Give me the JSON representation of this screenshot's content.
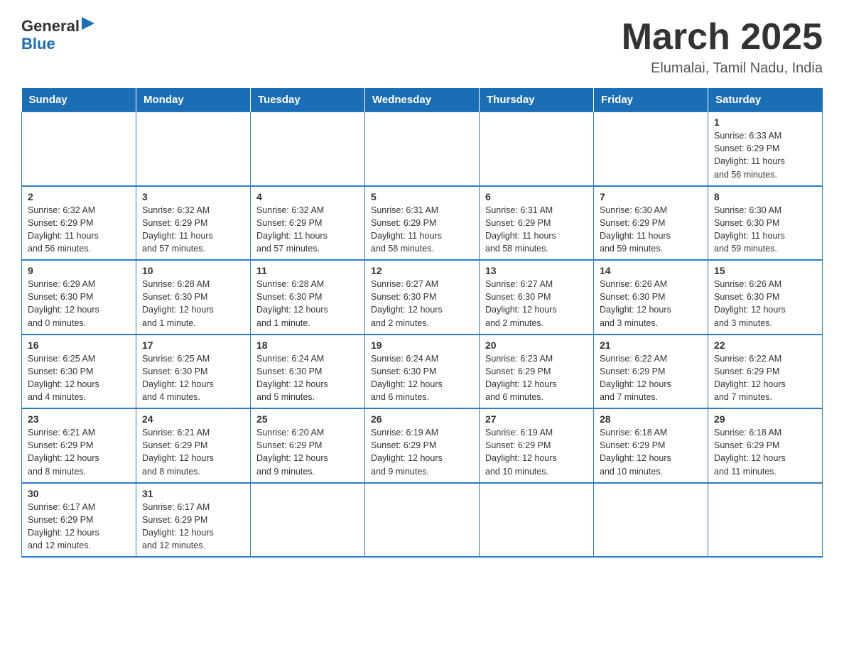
{
  "header": {
    "logo_general": "General",
    "logo_blue": "Blue",
    "title": "March 2025",
    "subtitle": "Elumalai, Tamil Nadu, India"
  },
  "weekdays": [
    "Sunday",
    "Monday",
    "Tuesday",
    "Wednesday",
    "Thursday",
    "Friday",
    "Saturday"
  ],
  "rows": [
    [
      {
        "day": "",
        "info": ""
      },
      {
        "day": "",
        "info": ""
      },
      {
        "day": "",
        "info": ""
      },
      {
        "day": "",
        "info": ""
      },
      {
        "day": "",
        "info": ""
      },
      {
        "day": "",
        "info": ""
      },
      {
        "day": "1",
        "info": "Sunrise: 6:33 AM\nSunset: 6:29 PM\nDaylight: 11 hours\nand 56 minutes."
      }
    ],
    [
      {
        "day": "2",
        "info": "Sunrise: 6:32 AM\nSunset: 6:29 PM\nDaylight: 11 hours\nand 56 minutes."
      },
      {
        "day": "3",
        "info": "Sunrise: 6:32 AM\nSunset: 6:29 PM\nDaylight: 11 hours\nand 57 minutes."
      },
      {
        "day": "4",
        "info": "Sunrise: 6:32 AM\nSunset: 6:29 PM\nDaylight: 11 hours\nand 57 minutes."
      },
      {
        "day": "5",
        "info": "Sunrise: 6:31 AM\nSunset: 6:29 PM\nDaylight: 11 hours\nand 58 minutes."
      },
      {
        "day": "6",
        "info": "Sunrise: 6:31 AM\nSunset: 6:29 PM\nDaylight: 11 hours\nand 58 minutes."
      },
      {
        "day": "7",
        "info": "Sunrise: 6:30 AM\nSunset: 6:29 PM\nDaylight: 11 hours\nand 59 minutes."
      },
      {
        "day": "8",
        "info": "Sunrise: 6:30 AM\nSunset: 6:30 PM\nDaylight: 11 hours\nand 59 minutes."
      }
    ],
    [
      {
        "day": "9",
        "info": "Sunrise: 6:29 AM\nSunset: 6:30 PM\nDaylight: 12 hours\nand 0 minutes."
      },
      {
        "day": "10",
        "info": "Sunrise: 6:28 AM\nSunset: 6:30 PM\nDaylight: 12 hours\nand 1 minute."
      },
      {
        "day": "11",
        "info": "Sunrise: 6:28 AM\nSunset: 6:30 PM\nDaylight: 12 hours\nand 1 minute."
      },
      {
        "day": "12",
        "info": "Sunrise: 6:27 AM\nSunset: 6:30 PM\nDaylight: 12 hours\nand 2 minutes."
      },
      {
        "day": "13",
        "info": "Sunrise: 6:27 AM\nSunset: 6:30 PM\nDaylight: 12 hours\nand 2 minutes."
      },
      {
        "day": "14",
        "info": "Sunrise: 6:26 AM\nSunset: 6:30 PM\nDaylight: 12 hours\nand 3 minutes."
      },
      {
        "day": "15",
        "info": "Sunrise: 6:26 AM\nSunset: 6:30 PM\nDaylight: 12 hours\nand 3 minutes."
      }
    ],
    [
      {
        "day": "16",
        "info": "Sunrise: 6:25 AM\nSunset: 6:30 PM\nDaylight: 12 hours\nand 4 minutes."
      },
      {
        "day": "17",
        "info": "Sunrise: 6:25 AM\nSunset: 6:30 PM\nDaylight: 12 hours\nand 4 minutes."
      },
      {
        "day": "18",
        "info": "Sunrise: 6:24 AM\nSunset: 6:30 PM\nDaylight: 12 hours\nand 5 minutes."
      },
      {
        "day": "19",
        "info": "Sunrise: 6:24 AM\nSunset: 6:30 PM\nDaylight: 12 hours\nand 6 minutes."
      },
      {
        "day": "20",
        "info": "Sunrise: 6:23 AM\nSunset: 6:29 PM\nDaylight: 12 hours\nand 6 minutes."
      },
      {
        "day": "21",
        "info": "Sunrise: 6:22 AM\nSunset: 6:29 PM\nDaylight: 12 hours\nand 7 minutes."
      },
      {
        "day": "22",
        "info": "Sunrise: 6:22 AM\nSunset: 6:29 PM\nDaylight: 12 hours\nand 7 minutes."
      }
    ],
    [
      {
        "day": "23",
        "info": "Sunrise: 6:21 AM\nSunset: 6:29 PM\nDaylight: 12 hours\nand 8 minutes."
      },
      {
        "day": "24",
        "info": "Sunrise: 6:21 AM\nSunset: 6:29 PM\nDaylight: 12 hours\nand 8 minutes."
      },
      {
        "day": "25",
        "info": "Sunrise: 6:20 AM\nSunset: 6:29 PM\nDaylight: 12 hours\nand 9 minutes."
      },
      {
        "day": "26",
        "info": "Sunrise: 6:19 AM\nSunset: 6:29 PM\nDaylight: 12 hours\nand 9 minutes."
      },
      {
        "day": "27",
        "info": "Sunrise: 6:19 AM\nSunset: 6:29 PM\nDaylight: 12 hours\nand 10 minutes."
      },
      {
        "day": "28",
        "info": "Sunrise: 6:18 AM\nSunset: 6:29 PM\nDaylight: 12 hours\nand 10 minutes."
      },
      {
        "day": "29",
        "info": "Sunrise: 6:18 AM\nSunset: 6:29 PM\nDaylight: 12 hours\nand 11 minutes."
      }
    ],
    [
      {
        "day": "30",
        "info": "Sunrise: 6:17 AM\nSunset: 6:29 PM\nDaylight: 12 hours\nand 12 minutes."
      },
      {
        "day": "31",
        "info": "Sunrise: 6:17 AM\nSunset: 6:29 PM\nDaylight: 12 hours\nand 12 minutes."
      },
      {
        "day": "",
        "info": ""
      },
      {
        "day": "",
        "info": ""
      },
      {
        "day": "",
        "info": ""
      },
      {
        "day": "",
        "info": ""
      },
      {
        "day": "",
        "info": ""
      }
    ]
  ]
}
